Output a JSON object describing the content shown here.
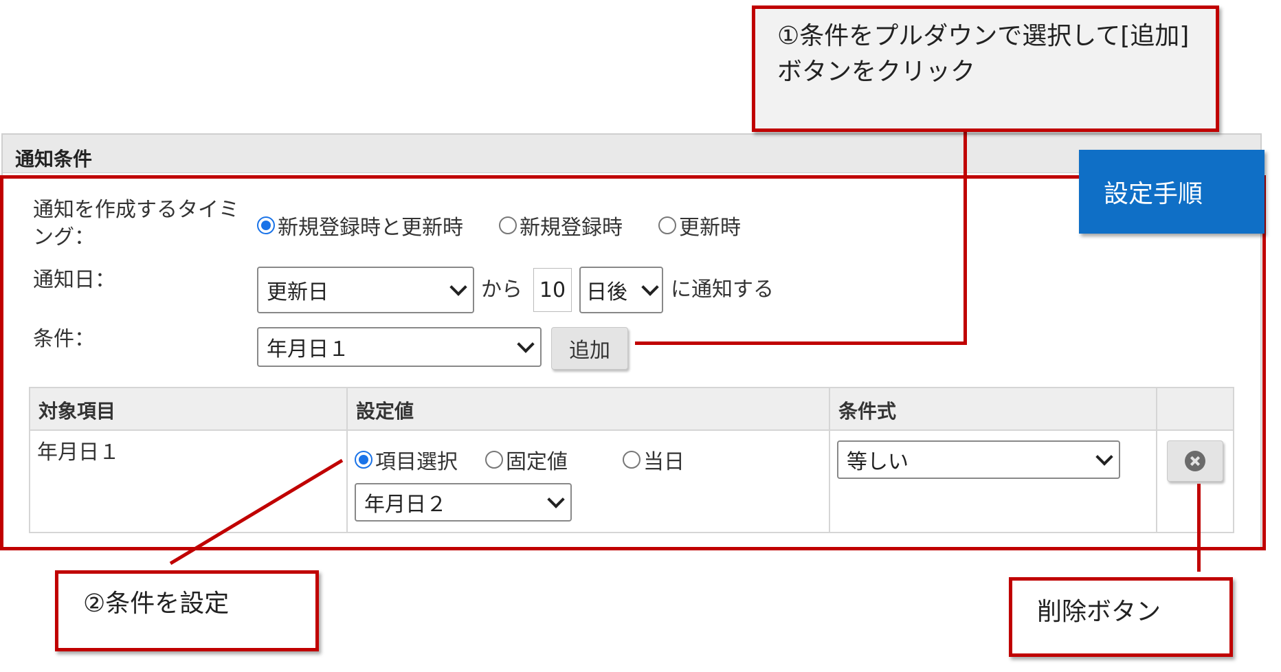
{
  "panel": {
    "title": "通知条件"
  },
  "timing": {
    "label": "通知を作成するタイミング：",
    "options": [
      {
        "label": "新規登録時と更新時",
        "selected": true
      },
      {
        "label": "新規登録時",
        "selected": false
      },
      {
        "label": "更新時",
        "selected": false
      }
    ]
  },
  "notify_date": {
    "label": "通知日：",
    "base_select": "更新日",
    "from_text": "から",
    "days_value": "10",
    "unit_select": "日後",
    "suffix_text": "に通知する"
  },
  "condition": {
    "label": "条件：",
    "select_value": "年月日１",
    "add_button": "追加"
  },
  "table": {
    "headers": [
      "対象項目",
      "設定値",
      "条件式",
      ""
    ],
    "row": {
      "target": "年月日１",
      "value_options": [
        {
          "label": "項目選択",
          "selected": true
        },
        {
          "label": "固定値",
          "selected": false
        },
        {
          "label": "当日",
          "selected": false
        }
      ],
      "value_select": "年月日２",
      "operator_select": "等しい"
    }
  },
  "annotations": {
    "step1": "①条件をプルダウンで選択して[追加]ボタンをクリック",
    "step2": "②条件を設定",
    "delete": "削除ボタン",
    "procedure": "設定手順"
  },
  "colors": {
    "annotation_red": "#c00000",
    "tag_blue": "#0f6fc6",
    "radio_blue": "#1a73e8"
  },
  "icons": {
    "delete": "x-circle-icon"
  }
}
